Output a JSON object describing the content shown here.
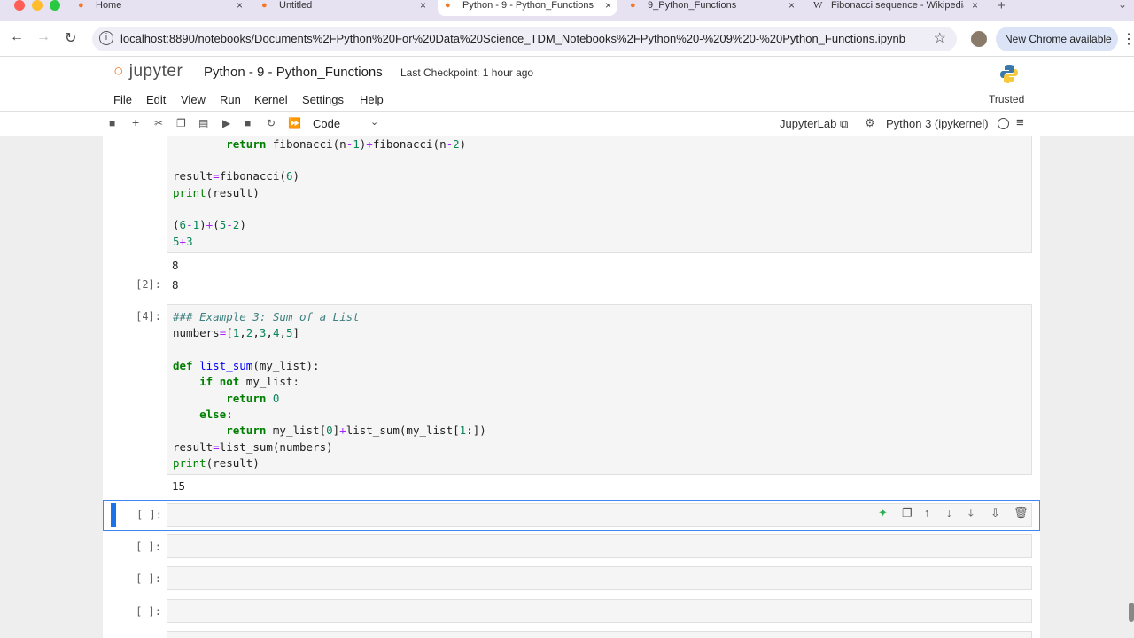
{
  "browser": {
    "tabs": [
      {
        "title": "Home",
        "icon": "jupyter-tab-icon"
      },
      {
        "title": "Untitled",
        "icon": "jupyter-tab-icon"
      },
      {
        "title": "Python - 9 - Python_Functions",
        "icon": "jupyter-tab-icon"
      },
      {
        "title": "9_Python_Functions",
        "icon": "jupyter-tab-icon"
      },
      {
        "title": "Fibonacci sequence - Wikipedia",
        "icon": "wikipedia-tab-icon"
      }
    ],
    "url": "localhost:8890/notebooks/Documents%2FPython%20For%20Data%20Science_TDM_Notebooks%2FPython%20-%209%20-%20Python_Functions.ipynb",
    "update_label": "New Chrome available"
  },
  "jupyter": {
    "logo_text": "jupyter",
    "notebook_title": "Python - 9 - Python_Functions",
    "checkpoint": "Last Checkpoint: 1 hour ago",
    "menus": [
      "File",
      "Edit",
      "View",
      "Run",
      "Kernel",
      "Settings",
      "Help"
    ],
    "trusted": "Trusted",
    "cell_type": "Code",
    "jupyterlab_link": "JupyterLab",
    "kernel": "Python 3 (ipykernel)"
  },
  "cells": {
    "cell1": {
      "lines": [
        "        return fibonacci(n-1)+fibonacci(n-2)",
        "",
        "result=fibonacci(6)",
        "print(result)",
        "",
        "(6-1)+(5-2)",
        "5+3"
      ],
      "output": "8"
    },
    "cell2": {
      "prompt": "[2]:",
      "output": "8"
    },
    "cell3": {
      "prompt": "[4]:",
      "lines": [
        "### Example 3: Sum of a List",
        "numbers=[1,2,3,4,5]",
        "",
        "def list_sum(my_list):",
        "    if not my_list:",
        "        return 0",
        "    else:",
        "        return my_list[0]+list_sum(my_list[1:])",
        "result=list_sum(numbers)",
        "print(result)"
      ],
      "output": "15"
    },
    "empty_prompts": [
      "[ ]:",
      "[ ]:",
      "[ ]:",
      "[ ]:"
    ]
  }
}
